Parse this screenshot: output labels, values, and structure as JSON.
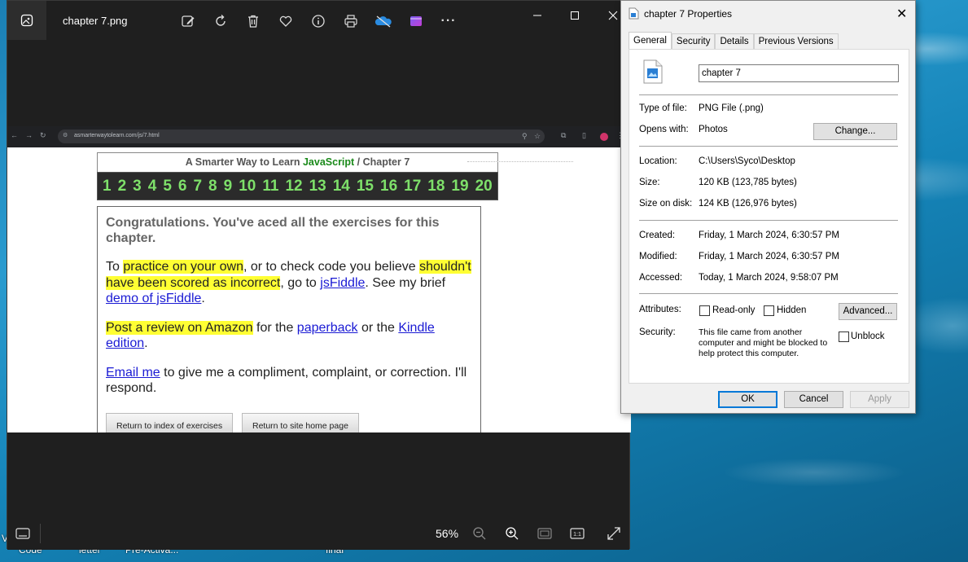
{
  "desktop": {
    "taskbar_labels": [
      "Code",
      "letter",
      "Pre-Activa...",
      "final"
    ],
    "edge_label": "V"
  },
  "photos": {
    "title": "chapter 7.png",
    "toolbar_icons": [
      "edit-icon",
      "rotate-icon",
      "delete-icon",
      "favorite-icon",
      "info-icon",
      "print-icon",
      "onedrive-icon",
      "clipchamp-icon",
      "more-icon"
    ],
    "zoom": "56%",
    "screenshot": {
      "url": "asmarterwaytolearn.com/js/7.html",
      "header_prefix": "A Smarter Way to Learn ",
      "header_js": "JavaScript",
      "header_suffix": " / Chapter 7",
      "numbers": [
        "1",
        "2",
        "3",
        "4",
        "5",
        "6",
        "7",
        "8",
        "9",
        "10",
        "11",
        "12",
        "13",
        "14",
        "15",
        "16",
        "17",
        "18",
        "19",
        "20"
      ],
      "congrats": "Congratulations. You've aced all the exercises for this chapter.",
      "p1_a": "To ",
      "p1_hl1": "practice on your own",
      "p1_b": ", or to check code you believe ",
      "p1_hl2": "shouldn't have been scored as incorrect",
      "p1_c": ", go to ",
      "p1_link1": "jsFiddle",
      "p1_d": ". See my brief ",
      "p1_link2": "demo of jsFiddle",
      "p1_e": ".",
      "p2_hl": "Post a review on Amazon",
      "p2_a": " for the ",
      "p2_link1": "paperback",
      "p2_b": " or the ",
      "p2_link2": "Kindle edition",
      "p2_c": ".",
      "p3_link": "Email me",
      "p3_a": " to give me a compliment, complaint, or correction. I'll respond.",
      "btn_index": "Return to index of exercises",
      "btn_home": "Return to site home page"
    }
  },
  "properties": {
    "title": "chapter 7 Properties",
    "tabs": [
      "General",
      "Security",
      "Details",
      "Previous Versions"
    ],
    "file_name": "chapter 7",
    "type_label": "Type of file:",
    "type_value": "PNG File (.png)",
    "opens_label": "Opens with:",
    "opens_value": "Photos",
    "change_btn": "Change...",
    "location_label": "Location:",
    "location_value": "C:\\Users\\Syco\\Desktop",
    "size_label": "Size:",
    "size_value": "120 KB (123,785 bytes)",
    "disk_label": "Size on disk:",
    "disk_value": "124 KB (126,976 bytes)",
    "created_label": "Created:",
    "created_value": "Friday, 1 March 2024, 6:30:57 PM",
    "modified_label": "Modified:",
    "modified_value": "Friday, 1 March 2024, 6:30:57 PM",
    "accessed_label": "Accessed:",
    "accessed_value": "Today, 1 March 2024, 9:58:07 PM",
    "attributes_label": "Attributes:",
    "readonly_label": "Read-only",
    "hidden_label": "Hidden",
    "advanced_btn": "Advanced...",
    "security_label": "Security:",
    "security_text": "This file came from another computer and might be blocked to help protect this computer.",
    "unblock_label": "Unblock",
    "ok": "OK",
    "cancel": "Cancel",
    "apply": "Apply"
  }
}
